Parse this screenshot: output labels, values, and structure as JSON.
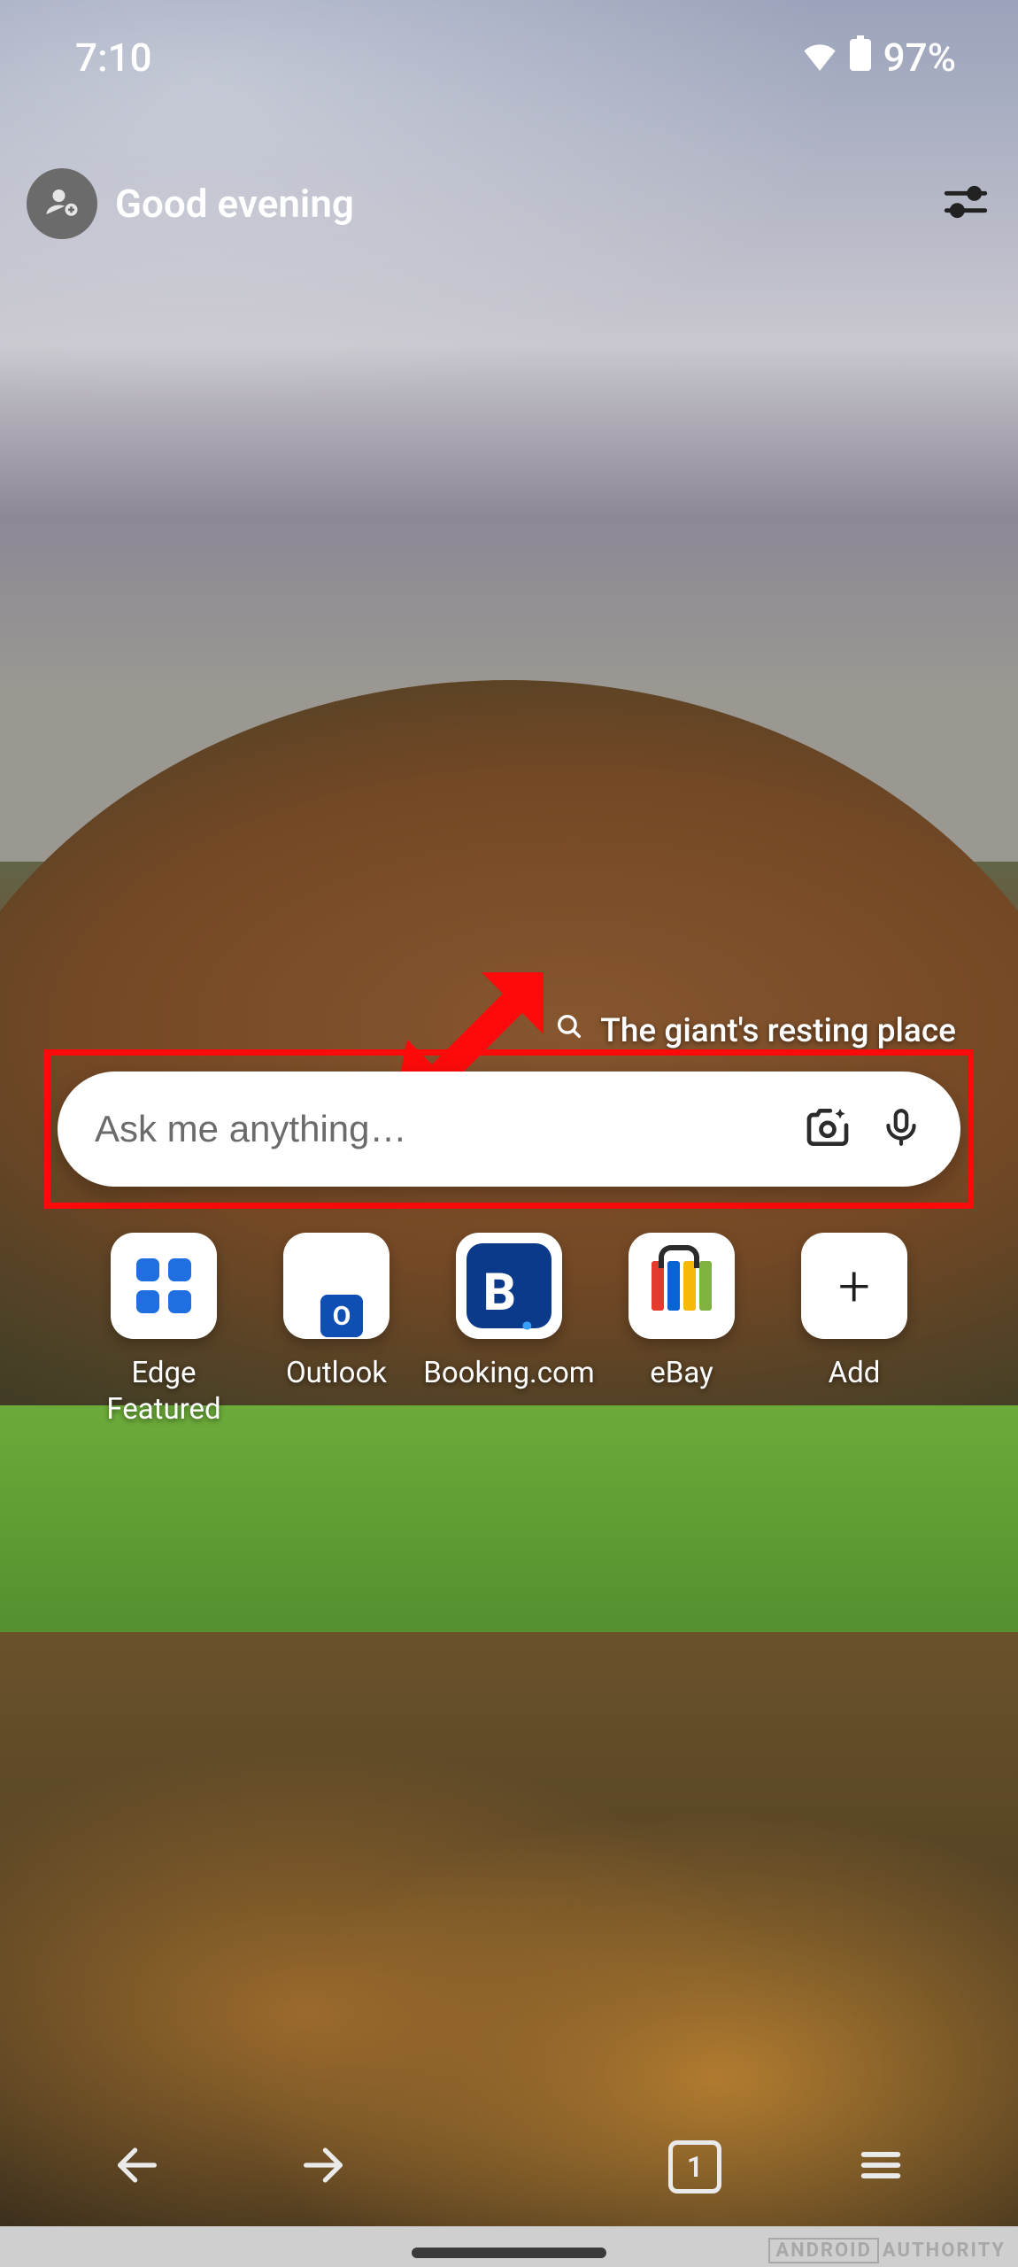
{
  "status": {
    "time": "7:10",
    "battery": "97%"
  },
  "header": {
    "greeting": "Good evening"
  },
  "background": {
    "caption": "The giant's resting place"
  },
  "search": {
    "placeholder": "Ask me anything…"
  },
  "shortcuts": [
    {
      "id": "edge-featured",
      "label": "Edge Featured"
    },
    {
      "id": "outlook",
      "label": "Outlook"
    },
    {
      "id": "booking",
      "label": "Booking.com"
    },
    {
      "id": "ebay",
      "label": "eBay"
    },
    {
      "id": "add",
      "label": "Add"
    }
  ],
  "nav": {
    "tab_count": "1"
  },
  "watermark": {
    "left": "ANDROID",
    "right": "AUTHORITY"
  },
  "annotation": {
    "type": "red-arrow-and-box",
    "target": "search-bar"
  }
}
